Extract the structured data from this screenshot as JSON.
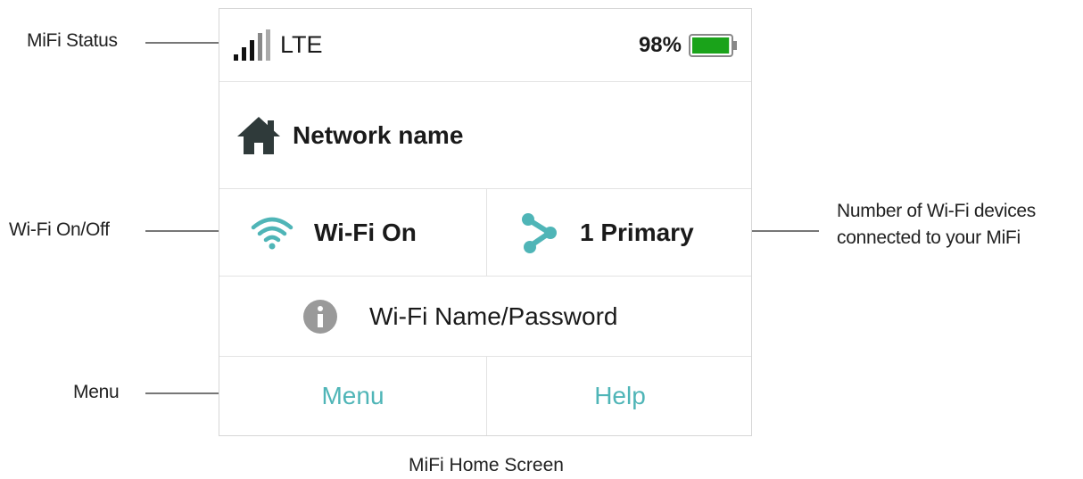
{
  "status_bar": {
    "network_type": "LTE",
    "battery_percent": "98%",
    "battery_level": 0.98,
    "signal_bars": 4,
    "icons": [
      "signal-strength-icon",
      "battery-icon"
    ]
  },
  "network": {
    "name": "Network name",
    "icon": "home-icon"
  },
  "wifi": {
    "status_label": "Wi-Fi On",
    "icon": "wifi-icon",
    "devices_label": "1 Primary",
    "devices_icon": "share-icon"
  },
  "info": {
    "label": "Wi-Fi Name/Password",
    "icon": "info-icon"
  },
  "menu_bar": {
    "menu_label": "Menu",
    "help_label": "Help"
  },
  "callouts": {
    "mifi_status": "MiFi Status",
    "wifi_onoff": "Wi-Fi On/Off",
    "menu": "Menu",
    "devices_line1": "Number of Wi-Fi devices",
    "devices_line2": "connected to your MiFi"
  },
  "caption": "MiFi Home Screen",
  "colors": {
    "accent": "#4fb5b7",
    "battery": "#1aa31a",
    "home_icon": "#2f3a3a",
    "info_icon": "#9a9a9a"
  }
}
